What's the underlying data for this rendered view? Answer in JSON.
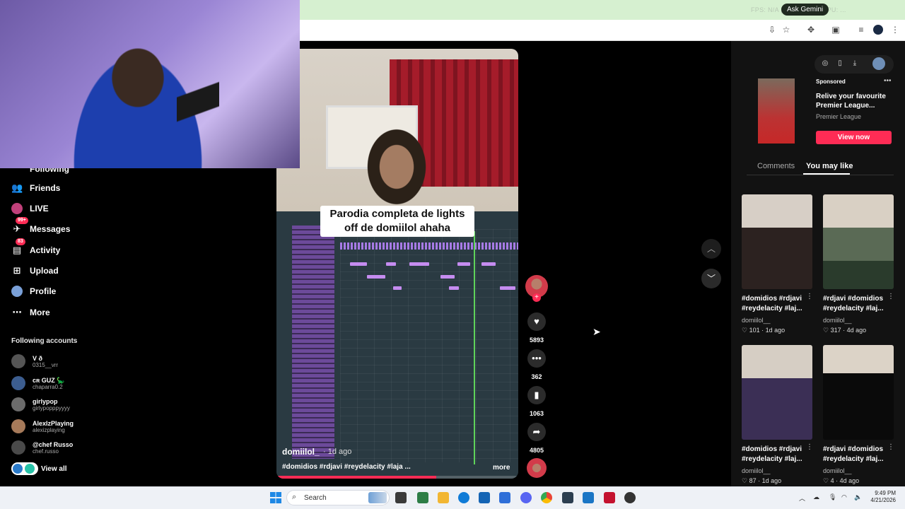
{
  "browser": {
    "gemini_label": "Ask Gemini",
    "fps_text": "FPS: N/A  |  GPU: 59%  |  CPU: ...",
    "toolbar_icons": [
      "install-icon",
      "star-icon",
      "extensions-icon",
      "media-icon",
      "reading-list-icon",
      "profile-icon",
      "menu-icon"
    ]
  },
  "sidebar": {
    "partial_top": "Following",
    "items": [
      {
        "label": "Friends",
        "icon": "friends-icon"
      },
      {
        "label": "LIVE",
        "icon": "live-icon"
      },
      {
        "label": "Messages",
        "icon": "messages-icon",
        "badge": "99+"
      },
      {
        "label": "Activity",
        "icon": "activity-icon",
        "badge": "83"
      },
      {
        "label": "Upload",
        "icon": "upload-icon"
      },
      {
        "label": "Profile",
        "icon": "profile-icon"
      },
      {
        "label": "More",
        "icon": "more-icon"
      }
    ],
    "following_title": "Following accounts",
    "accounts": [
      {
        "name": "V ð",
        "handle": "0315__vrr"
      },
      {
        "name": "ᴄʀ GUZ 🦕",
        "handle": "chaparra0.2"
      },
      {
        "name": "girlypop",
        "handle": "girlypopppyyyy"
      },
      {
        "name": "AlexIzPlaying",
        "handle": "alexizplaying"
      },
      {
        "name": "@chef Russo",
        "handle": "chef.russo"
      }
    ],
    "view_all": "View all"
  },
  "video": {
    "caption": "Parodia completa de lights off de domiilol ahaha",
    "author": "domiilol_",
    "time": "· 1d ago",
    "description": "#domidios #rdjavi #reydelacity #laja ...",
    "more": "more",
    "progress": 0.66,
    "accent_color": "#fe2c55"
  },
  "actions": {
    "likes": "5893",
    "comments": "362",
    "saves": "1063",
    "shares": "4805"
  },
  "ad": {
    "label": "Sponsored",
    "title": "Relive your favourite Premier League...",
    "brand": "Premier League",
    "cta": "View now"
  },
  "tabs": {
    "comments": "Comments",
    "you_may_like": "You may like"
  },
  "recommendations": [
    {
      "desc": "#domidios #rdjavi #reydelacity #laj...",
      "author": "domiilol__",
      "stats": "♡ 101 · 1d ago"
    },
    {
      "desc": "#rdjavi #domidios #reydelacity #laj...",
      "author": "domiilol__",
      "stats": "♡ 317 · 4d ago"
    },
    {
      "desc": "#domidios #rdjavi #reydelacity #laj...",
      "author": "domiilol__",
      "stats": "♡ 87 · 1d ago"
    },
    {
      "desc": "#rdjavi #domidios #reydelacity #laj...",
      "author": "domiilol__",
      "stats": "♡ 4 · 4d ago"
    }
  ],
  "taskbar": {
    "search_placeholder": "Search",
    "time": "9:49 PM",
    "date": "4/21/2026"
  }
}
